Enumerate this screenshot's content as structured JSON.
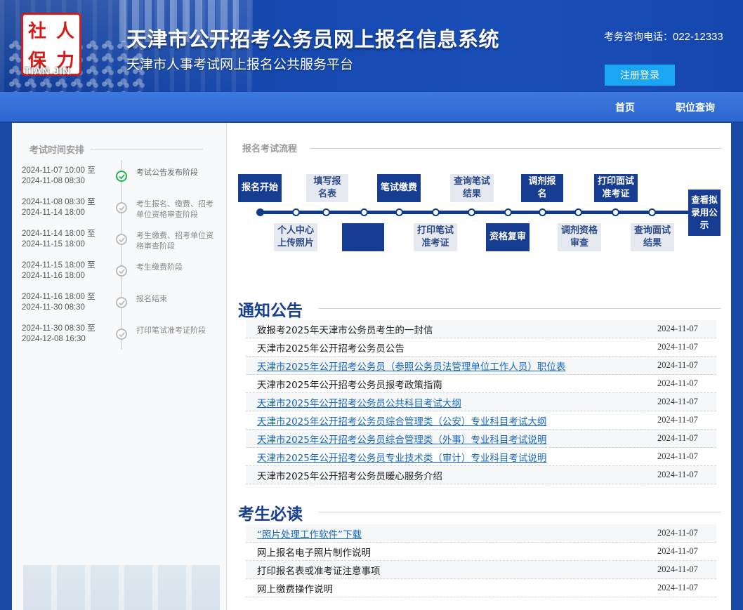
{
  "header": {
    "logo_chars": [
      "社",
      "人",
      "保",
      "力"
    ],
    "logo_en": "TIAN JIN",
    "title": "天津市公开招考公务员网上报名信息系统",
    "subtitle": "天津市人事考试网上报名公共服务平台",
    "hotline_label": "考务咨询电话：",
    "hotline_number": "022-12333",
    "login_label": "注册登录"
  },
  "nav": {
    "home": "首页",
    "position_query": "职位查询"
  },
  "schedule": {
    "heading": "考试时间安排",
    "items": [
      {
        "start": "2024-11-07 10:00 至",
        "end": "2024-11-08 08:30",
        "label": "考试公告发布阶段",
        "active": true
      },
      {
        "start": "2024-11-08 08:30 至",
        "end": "2024-11-14 18:00",
        "label": "考生报名、缴费、招考单位资格审查阶段",
        "active": false
      },
      {
        "start": "2024-11-14 18:00 至",
        "end": "2024-11-15 18:00",
        "label": "考生缴费、招考单位资格审查阶段",
        "active": false
      },
      {
        "start": "2024-11-15 18:00 至",
        "end": "2024-11-16 18:00",
        "label": "考生缴费阶段",
        "active": false
      },
      {
        "start": "2024-11-16 18:00 至",
        "end": "2024-11-30 08:30",
        "label": "报名结束",
        "active": false
      },
      {
        "start": "2024-11-30 08:30 至",
        "end": "2024-12-08 16:30",
        "label": "打印笔试准考证阶段",
        "active": false
      }
    ]
  },
  "flow": {
    "heading": "报名考试流程",
    "steps_top": [
      "报名开始",
      "填写报名表",
      "笔试缴费",
      "查询笔试结果",
      "调剂报名",
      "打印面试准考证"
    ],
    "steps_bottom": [
      "个人中心上传照片",
      "",
      "打印笔试准考证",
      "资格复审",
      "调剂资格审查",
      "查询面试结果"
    ],
    "final_step": "查看拟录用公示"
  },
  "notices": {
    "heading": "通知公告",
    "items": [
      {
        "title": "致报考2025年天津市公务员考生的一封信",
        "date": "2024-11-07",
        "link": false
      },
      {
        "title": "天津市2025年公开招考公务员公告",
        "date": "2024-11-07",
        "link": false
      },
      {
        "title": "天津市2025年公开招考公务员（参照公务员法管理单位工作人员）职位表",
        "date": "2024-11-07",
        "link": true
      },
      {
        "title": "天津市2025年公开招考公务员报考政策指南",
        "date": "2024-11-07",
        "link": false
      },
      {
        "title": "天津市2025年公开招考公务员公共科目考试大纲",
        "date": "2024-11-07",
        "link": true
      },
      {
        "title": "天津市2025年公开招考公务员综合管理类（公安）专业科目考试大纲",
        "date": "2024-11-07",
        "link": true
      },
      {
        "title": "天津市2025年公开招考公务员综合管理类（外事）专业科目考试说明",
        "date": "2024-11-07",
        "link": true
      },
      {
        "title": "天津市2025年公开招考公务员专业技术类（审计）专业科目考试说明",
        "date": "2024-11-07",
        "link": true
      },
      {
        "title": "天津市2025年公开招考公务员暖心服务介绍",
        "date": "2024-11-07",
        "link": false
      }
    ]
  },
  "must_read": {
    "heading": "考生必读",
    "items": [
      {
        "title": "“照片处理工作软件”下载",
        "date": "2024-11-07",
        "link": true
      },
      {
        "title": "网上报名电子照片制作说明",
        "date": "2024-11-07",
        "link": false
      },
      {
        "title": "打印报名表或准考证注意事项",
        "date": "2024-11-07",
        "link": false
      },
      {
        "title": "网上缴费操作说明",
        "date": "2024-11-07",
        "link": false
      }
    ]
  },
  "colors": {
    "brand_blue": "#163d91",
    "link_blue": "#1567c0",
    "login_button": "#1aa6f3",
    "active_green": "#20b14c"
  }
}
